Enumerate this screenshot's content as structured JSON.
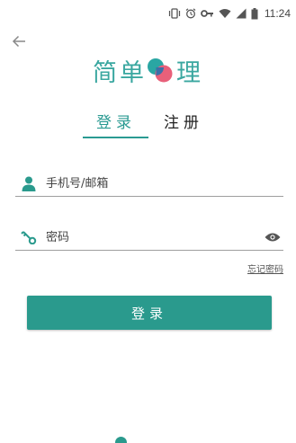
{
  "status_bar": {
    "time": "11:24",
    "icons": [
      "vibrate-icon",
      "alarm-icon",
      "key-icon",
      "wifi-icon",
      "signal-icon",
      "battery-icon"
    ]
  },
  "nav": {
    "back_icon": "arrow-left-icon"
  },
  "logo": {
    "left_text": "简单",
    "right_text": "理",
    "colors": {
      "text": "#3aa7a0",
      "mark_teal": "#2aa6a3",
      "mark_pink": "#e8607a",
      "mark_blue": "#3b6fa8"
    }
  },
  "tabs": {
    "login_label": "登录",
    "register_label": "注册",
    "active": "login"
  },
  "form": {
    "username": {
      "placeholder": "手机号/邮箱",
      "value": "",
      "icon": "person-icon"
    },
    "password": {
      "placeholder": "密码",
      "value": "",
      "icon": "key-icon",
      "toggle_icon": "eye-icon"
    },
    "forgot_label": "忘记密码",
    "submit_label": "登录"
  },
  "colors": {
    "accent": "#2a9a8d",
    "divider": "#9e9e9e"
  }
}
